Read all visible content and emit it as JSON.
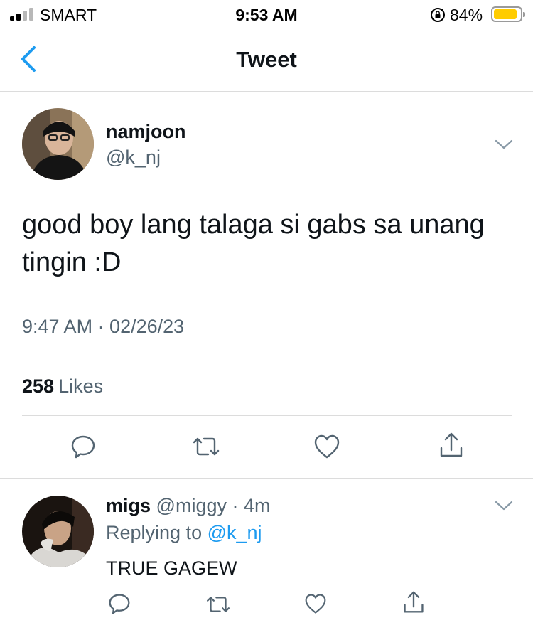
{
  "status_bar": {
    "carrier": "SMART",
    "time": "9:53 AM",
    "battery_percent": "84%",
    "signal_bars": 2,
    "battery_level": 0.84,
    "battery_color": "#ffcc00"
  },
  "nav": {
    "title": "Tweet",
    "back_icon": "chevron-left-icon"
  },
  "tweet": {
    "display_name": "namjoon",
    "handle": "@k_nj",
    "text": "good boy lang talaga si gabs sa unang tingin :D",
    "timestamp": "9:47 AM · 02/26/23",
    "likes_count": "258",
    "likes_label": "Likes",
    "actions": [
      "reply-icon",
      "retweet-icon",
      "like-icon",
      "share-icon"
    ]
  },
  "reply": {
    "display_name": "migs",
    "meta": "@miggy · 4m",
    "replying_prefix": "Replying to",
    "replying_to": "@k_nj",
    "text": "TRUE GAGEW",
    "actions": [
      "reply-icon",
      "retweet-icon",
      "like-icon",
      "share-icon"
    ]
  },
  "colors": {
    "accent": "#1d9bf0",
    "secondary_text": "#536471",
    "primary_text": "#0f1419",
    "divider": "#dcdcdc"
  }
}
